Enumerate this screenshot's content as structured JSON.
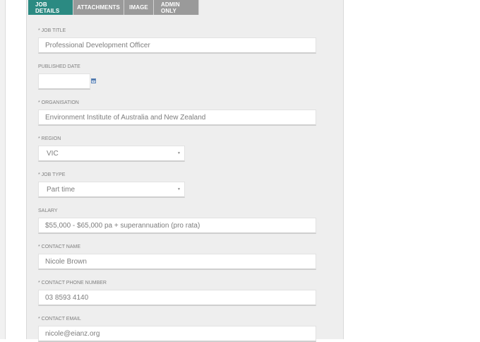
{
  "tabs": [
    {
      "label": "JOB DETAILS",
      "active": true
    },
    {
      "label": "ATTACHMENTS",
      "active": false
    },
    {
      "label": "IMAGE",
      "active": false
    },
    {
      "label": "ADMIN ONLY",
      "active": false
    }
  ],
  "fields": {
    "job_title": {
      "label": "* JOB TITLE",
      "value": "Professional Development Officer"
    },
    "published_date": {
      "label": "PUBLISHED DATE",
      "value": ""
    },
    "organisation": {
      "label": "* ORGANISATION",
      "value": "Environment Institute of Australia and New Zealand"
    },
    "region": {
      "label": "* REGION",
      "value": "VIC"
    },
    "job_type": {
      "label": "* JOB TYPE",
      "value": "Part time"
    },
    "salary": {
      "label": "SALARY",
      "value": "$55,000 - $65,000 pa + superannuation (pro rata)"
    },
    "contact_name": {
      "label": "* CONTACT NAME",
      "value": "Nicole Brown"
    },
    "contact_phone": {
      "label": "* CONTACT PHONE NUMBER",
      "value": "03 8593 4140"
    },
    "contact_email": {
      "label": "* CONTACT EMAIL",
      "value": "nicole@eianz.org"
    }
  },
  "icons": {
    "select_arrow": "chevron-down-icon",
    "date_picker": "calendar-icon"
  },
  "colors": {
    "active_tab": "#2b8a82",
    "inactive_tab": "#9a9a9a",
    "panel_background": "#eeeeee"
  }
}
